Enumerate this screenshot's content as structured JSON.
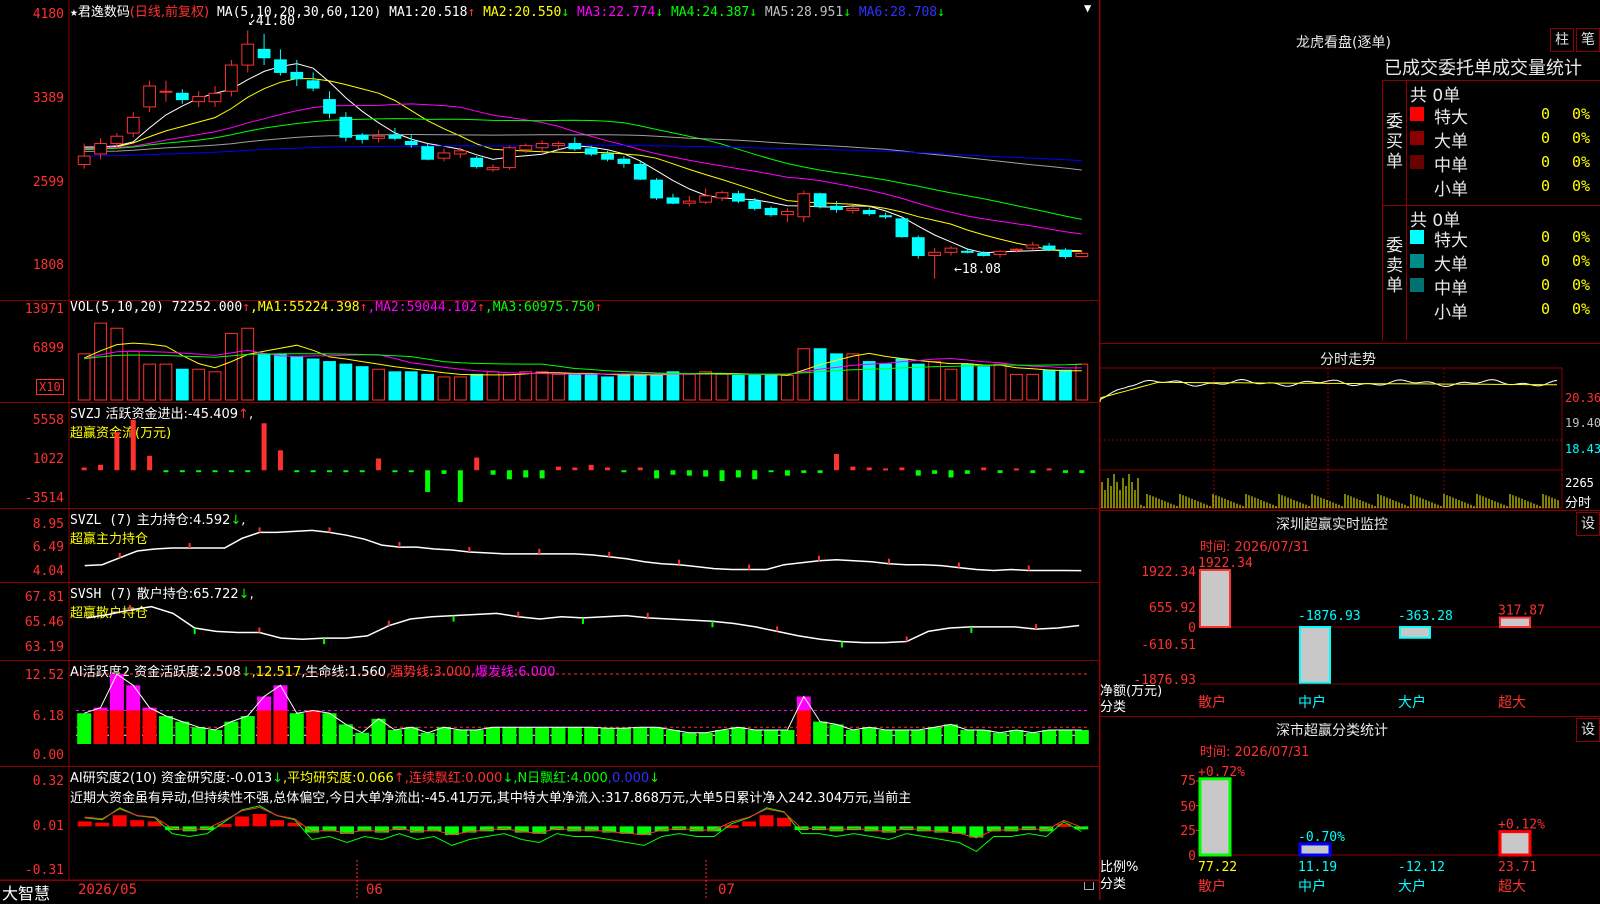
{
  "colors": {
    "up": "#ff3030",
    "down": "#00ffff",
    "grid": "#8b0000",
    "ma1": "#ffffff",
    "ma2": "#ffff00",
    "ma3": "#ff00ff",
    "ma4": "#00ff00",
    "ma5": "#a0a0a0",
    "ma6": "#0000ff"
  },
  "title_bar": {
    "star": "★",
    "stock": "君逸数码",
    "period": "(日线,前复权)"
  },
  "main": {
    "axis": [
      "4180",
      "3389",
      "2599",
      "1808"
    ],
    "ma_label": "MA(5,10,20,30,60,120)",
    "mas": [
      {
        "name": "MA1:",
        "value": "20.518",
        "arrow": "↑",
        "color": "#ffffff"
      },
      {
        "name": "MA2:",
        "value": "20.550",
        "arrow": "↓",
        "color": "#ffff00"
      },
      {
        "name": "MA3:",
        "value": "22.774",
        "arrow": "↓",
        "color": "#ff00ff"
      },
      {
        "name": "MA4:",
        "value": "24.387",
        "arrow": "↓",
        "color": "#00ff00"
      },
      {
        "name": "MA5:",
        "value": "28.951",
        "arrow": "↓",
        "color": "#c0c0c0"
      },
      {
        "name": "MA6:",
        "value": "28.708",
        "arrow": "↓",
        "color": "#3030ff"
      }
    ],
    "high_label": "41.80",
    "low_label": "←18.08"
  },
  "vol": {
    "axis": [
      "13971",
      "6899"
    ],
    "unit": "X10",
    "label": "VOL(5,10,20)",
    "value": "72252.000",
    "arrow": "↑",
    "mas": [
      {
        "name": "MA1:",
        "value": "55224.398",
        "arrow": "↑",
        "color": "#ffff00"
      },
      {
        "name": "MA2:",
        "value": "59044.102",
        "arrow": "↑",
        "color": "#ff00ff"
      },
      {
        "name": "MA3:",
        "value": "60975.750",
        "arrow": "↑",
        "color": "#00ff00"
      }
    ]
  },
  "svzj": {
    "axis": [
      "5558",
      "1022",
      "-3514"
    ],
    "label": "SVZJ",
    "line1": "活跃资金进出:",
    "value": "-45.409",
    "arrow": "↑",
    "tail": ",",
    "sub": "超赢资金流(万元)"
  },
  "svzl": {
    "axis": [
      "8.95",
      "6.49",
      "4.04"
    ],
    "label": "SVZL (7)",
    "line1": "主力持仓:",
    "value": "4.592",
    "arrow": "↓",
    "tail": ",",
    "sub": "超赢主力持仓"
  },
  "svsh": {
    "axis": [
      "67.81",
      "65.46",
      "63.19"
    ],
    "label": "SVSH (7)",
    "line1": "散户持仓:",
    "value": "65.722",
    "arrow": "↓",
    "tail": ",",
    "sub": "超赢散户持仓"
  },
  "ai1": {
    "axis": [
      "12.52",
      "6.18",
      "0.00"
    ],
    "label": "AI活跃度2",
    "items": [
      {
        "t": "资金活跃度:",
        "v": "2.508",
        "a": "↓",
        "c": "#ffffff"
      },
      {
        "t": ",",
        "v": "12.517",
        "a": "",
        "c": "#ffff00"
      },
      {
        "t": ",生命线:",
        "v": "1.560",
        "a": "",
        "c": "#ffffff"
      },
      {
        "t": ",强势线:",
        "v": "3.000",
        "a": "",
        "c": "#ff3030"
      },
      {
        "t": ",爆发线:",
        "v": "6.000",
        "a": "",
        "c": "#ff00ff"
      }
    ]
  },
  "ai2": {
    "axis": [
      "0.32",
      "0.01",
      "-0.31"
    ],
    "label": "AI研究度2(10)",
    "items": [
      {
        "t": "资金研究度:",
        "v": "-0.013",
        "a": "↓",
        "c": "#ffffff"
      },
      {
        "t": ",平均研究度:",
        "v": "0.066",
        "a": "↑",
        "c": "#ffff00"
      },
      {
        "t": ",连续飘红:",
        "v": "0.000",
        "a": "↓",
        "c": "#ff3030"
      },
      {
        "t": ",N日飘红:",
        "v": "4.000",
        "a": "",
        "c": "#00ff00"
      },
      {
        "t": ",",
        "v": "0.000",
        "a": "↓",
        "c": "#3030ff"
      }
    ],
    "comment": "近期大资金虽有异动,但持续性不强,总体偏空,今日大单净流出:-45.41万元,其中特大单净流入:317.868万元,大单5日累计净入242.304万元,当前主"
  },
  "date_axis": {
    "brand": "大智慧",
    "labels": [
      "2026/05",
      "06",
      "07"
    ]
  },
  "right": {
    "dragon_title": "龙虎看盘(逐单)",
    "btn_bar": "柱",
    "btn_pen": "笔",
    "stats_title": "已成交委托单成交量统计",
    "buy": {
      "side": "委买单",
      "total": "共 0单",
      "rows": [
        {
          "name": "特大",
          "n": "0",
          "p": "0%",
          "color": "#ff0000"
        },
        {
          "name": "大单",
          "n": "0",
          "p": "0%",
          "color": "#8b0000"
        },
        {
          "name": "中单",
          "n": "0",
          "p": "0%",
          "color": "#6a0000"
        },
        {
          "name": "小单",
          "n": "0",
          "p": "0%",
          "color": ""
        }
      ]
    },
    "sell": {
      "side": "委卖单",
      "total": "共 0单",
      "rows": [
        {
          "name": "特大",
          "n": "0",
          "p": "0%",
          "color": "#00ffff"
        },
        {
          "name": "大单",
          "n": "0",
          "p": "0%",
          "color": "#008b8b"
        },
        {
          "name": "中单",
          "n": "0",
          "p": "0%",
          "color": "#007070"
        },
        {
          "name": "小单",
          "n": "0",
          "p": "0%",
          "color": ""
        }
      ]
    },
    "intraday": {
      "title": "分时走势",
      "axis": [
        "20.36",
        "19.40",
        "18.43"
      ],
      "vol_axis": "2265",
      "vol_unit": "分时"
    },
    "sz_monitor": {
      "title": "深圳超赢实时监控",
      "btn": "设",
      "time": "时间: 2026/07/31",
      "axis": [
        "1922.34",
        "655.92",
        "0",
        "-610.51",
        "-1876.93"
      ],
      "ylabel1": "净额(万元)",
      "ylabel2": "分类",
      "cats": [
        "散户",
        "中户",
        "大户",
        "超大"
      ],
      "vals": [
        "1922.34",
        "-1876.93",
        "-363.28",
        "317.87"
      ]
    },
    "sz_class": {
      "title": "深市超赢分类统计",
      "btn": "设",
      "time": "时间: 2026/07/31",
      "axis": [
        "75",
        "50",
        "25",
        "0"
      ],
      "ylabel1": "比例%",
      "ylabel2": "分类",
      "cats": [
        "散户",
        "中户",
        "大户",
        "超大"
      ],
      "top": [
        "+0.72%",
        "-0.70%",
        "",
        "+0.12%"
      ],
      "vals": [
        "77.22",
        "11.19",
        "-12.12",
        "23.71"
      ]
    }
  },
  "chart_data": [
    {
      "type": "candlestick",
      "title": "君逸数码 (日线,前复权)",
      "ylim": [
        18.08,
        41.8
      ],
      "ohlc": [
        [
          29,
          31,
          28.6,
          29.8
        ],
        [
          30,
          31.5,
          29.5,
          31
        ],
        [
          31,
          32,
          30.5,
          31.7
        ],
        [
          32,
          34,
          31.6,
          33.5
        ],
        [
          34.5,
          37,
          34,
          36.5
        ],
        [
          36,
          37,
          35,
          36
        ],
        [
          35.8,
          36.2,
          34.8,
          35.2
        ],
        [
          35,
          36,
          34.5,
          35.5
        ],
        [
          35,
          36.5,
          34.5,
          35.8
        ],
        [
          36,
          39,
          35.5,
          38.5
        ],
        [
          38.5,
          41.8,
          37.8,
          40.5
        ],
        [
          40,
          41.5,
          38.5,
          39.2
        ],
        [
          39,
          40,
          37.5,
          37.8
        ],
        [
          37.8,
          39,
          36.5,
          37.2
        ],
        [
          37,
          37.8,
          36,
          36.3
        ],
        [
          35.2,
          36,
          33.4,
          33.9
        ],
        [
          33.5,
          34,
          31.2,
          31.6
        ],
        [
          31.8,
          32,
          31,
          31.4
        ],
        [
          31.5,
          32.3,
          31.1,
          31.7
        ],
        [
          31.8,
          32.5,
          31.3,
          31.5
        ],
        [
          31.2,
          31.8,
          30.6,
          30.9
        ],
        [
          30.7,
          31,
          29.4,
          29.5
        ],
        [
          29.6,
          30.5,
          29.3,
          30.1
        ],
        [
          30,
          30.6,
          29.6,
          30.3
        ],
        [
          29.6,
          29.8,
          28.6,
          28.8
        ],
        [
          28.5,
          29,
          28.3,
          28.7
        ],
        [
          28.7,
          30.8,
          28.5,
          30.6
        ],
        [
          30.4,
          31,
          30.1,
          30.8
        ],
        [
          30.6,
          31.3,
          30.2,
          31
        ],
        [
          30.8,
          31.2,
          30.4,
          31
        ],
        [
          31,
          31.6,
          30.3,
          30.5
        ],
        [
          30.5,
          30.8,
          29.8,
          30
        ],
        [
          30,
          30.3,
          29.3,
          29.5
        ],
        [
          29.5,
          29.8,
          28.7,
          29.1
        ],
        [
          29,
          29.3,
          27.5,
          27.6
        ],
        [
          27.5,
          27.7,
          25.6,
          25.8
        ],
        [
          25.8,
          26.2,
          25.2,
          25.3
        ],
        [
          25.3,
          26,
          25,
          25.5
        ],
        [
          25.4,
          26.7,
          25.2,
          26
        ],
        [
          25.8,
          26.5,
          25.5,
          26.3
        ],
        [
          26.2,
          26.5,
          25.3,
          25.5
        ],
        [
          25.5,
          25.8,
          24.6,
          24.8
        ],
        [
          24.8,
          25,
          24,
          24.2
        ],
        [
          24.2,
          24.8,
          23.5,
          24.5
        ],
        [
          24,
          26.5,
          23.5,
          26.2
        ],
        [
          26.2,
          26.3,
          24.8,
          25
        ],
        [
          25,
          25.5,
          24.4,
          24.7
        ],
        [
          24.6,
          25,
          24.3,
          24.8
        ],
        [
          24.6,
          24.9,
          24.1,
          24.3
        ],
        [
          24.1,
          24.4,
          23.8,
          24
        ],
        [
          23.8,
          23.9,
          22,
          22.1
        ],
        [
          22,
          22.2,
          20,
          20.3
        ],
        [
          20.3,
          21,
          18.08,
          20.6
        ],
        [
          20.6,
          21.2,
          20.3,
          21
        ],
        [
          20.7,
          21,
          20.5,
          20.6
        ],
        [
          20.5,
          20.7,
          20.2,
          20.3
        ],
        [
          20.4,
          20.8,
          20.1,
          20.7
        ],
        [
          20.8,
          21,
          20.6,
          20.9
        ],
        [
          21,
          21.6,
          20.8,
          21.3
        ],
        [
          21.2,
          21.5,
          20.7,
          20.9
        ],
        [
          20.8,
          21,
          20,
          20.2
        ],
        [
          20.2,
          20.8,
          20.1,
          20.5
        ]
      ]
    },
    {
      "type": "bar",
      "title": "VOL(5,10,20)",
      "values": [
        9,
        15,
        14,
        9.5,
        7,
        7,
        6,
        6,
        5.5,
        13,
        14,
        9,
        9,
        8.5,
        8,
        7.5,
        7,
        6.5,
        6,
        5.5,
        5.5,
        5,
        4.5,
        4.5,
        5,
        5.5,
        5,
        5.5,
        5.5,
        5,
        5,
        5,
        4.5,
        5,
        5,
        5,
        5.5,
        5,
        5.5,
        5,
        4.8,
        4.8,
        4.8,
        4.8,
        10,
        10,
        9,
        9,
        7.5,
        7,
        8,
        7,
        7.5,
        6,
        7,
        6.5,
        7,
        5,
        5,
        5.8,
        5.8,
        7
      ]
    },
    {
      "type": "bar",
      "title": "SVZJ 超赢资金流(万元)",
      "values": [
        300,
        600,
        4200,
        5558,
        1600,
        -200,
        -200,
        -200,
        -200,
        -200,
        -100,
        5200,
        2200,
        -100,
        -100,
        -100,
        -200,
        -100,
        1300,
        -100,
        -200,
        -2400,
        -400,
        -3514,
        1400,
        -500,
        -1000,
        -800,
        -900,
        400,
        300,
        600,
        300,
        -100,
        300,
        -900,
        -500,
        -600,
        -700,
        -1200,
        -800,
        -1000,
        -200,
        -600,
        -300,
        -300,
        1800,
        400,
        300,
        200,
        300,
        -600,
        -400,
        -800,
        -400,
        300,
        -300,
        200,
        -300,
        200,
        -300,
        -300
      ]
    },
    {
      "type": "line",
      "title": "SVZL 超赢主力持仓",
      "ylim": [
        4.04,
        8.95
      ],
      "values": [
        5.1,
        5.2,
        5.9,
        6.6,
        6.8,
        6.9,
        6.9,
        6.9,
        6.9,
        7.9,
        8.5,
        8.5,
        8.6,
        8.7,
        8.5,
        8.2,
        7.8,
        7.2,
        7,
        7,
        6.8,
        6.7,
        6.5,
        6.4,
        6.3,
        6.3,
        6.3,
        6.3,
        6.3,
        6.2,
        6,
        5.8,
        5.5,
        5.3,
        5.2,
        5,
        4.8,
        4.7,
        4.7,
        4.7,
        5.2,
        5.4,
        5.6,
        5.7,
        5.6,
        5.5,
        5.3,
        5.2,
        5.2,
        5.1,
        4.9,
        4.7,
        4.6,
        4.7,
        4.6,
        4.6,
        4.6,
        4.59
      ]
    },
    {
      "type": "line",
      "title": "SVSH 超赢散户持仓",
      "ylim": [
        63.19,
        67.81
      ],
      "values": [
        66.4,
        66.7,
        67.1,
        67.4,
        66.8,
        65.5,
        65.2,
        65.1,
        65.1,
        64.6,
        64.5,
        64.6,
        64.6,
        64.8,
        65.7,
        66.3,
        66.5,
        66.6,
        66.7,
        66.8,
        66.5,
        66.3,
        66.5,
        66.4,
        66.5,
        66.6,
        66.4,
        66.3,
        66.2,
        66.1,
        65.9,
        65.6,
        65.2,
        64.8,
        64.5,
        64.3,
        64.2,
        64.2,
        64.3,
        65.2,
        65.5,
        65.6,
        65.6,
        65.6,
        65.4,
        65.5,
        65.72
      ]
    },
    {
      "type": "bar",
      "title": "AI活跃度2 资金活跃度",
      "ylim": [
        0,
        12.52
      ],
      "values": [
        5.5,
        6.5,
        12.5,
        10.5,
        6.5,
        5,
        4,
        3,
        2.5,
        4,
        5,
        8.5,
        10.5,
        5.5,
        6,
        5.5,
        3.5,
        2,
        4.5,
        2.5,
        3,
        2,
        3,
        2.5,
        2.5,
        3,
        3,
        3,
        3,
        3,
        3,
        3,
        2.8,
        2.8,
        3,
        3,
        2.5,
        2,
        2,
        2.5,
        3,
        2.5,
        2.5,
        2.5,
        8.5,
        4,
        3.5,
        2.5,
        3,
        2.5,
        2.5,
        2.5,
        3,
        3.5,
        2.5,
        2.5,
        2,
        2.5,
        2,
        2.5,
        2.5,
        2.508
      ]
    },
    {
      "type": "bar",
      "title": "AI研究度2(10) 资金研究度",
      "ylim": [
        -0.31,
        0.32
      ],
      "values": [
        0.05,
        0.04,
        0.1,
        0.06,
        0.05,
        -0.02,
        -0.03,
        -0.02,
        0.03,
        0.09,
        0.11,
        0.06,
        0.04,
        -0.04,
        -0.03,
        -0.05,
        -0.03,
        -0.04,
        -0.02,
        -0.04,
        -0.03,
        -0.06,
        -0.04,
        -0.03,
        -0.02,
        -0.04,
        -0.05,
        -0.02,
        -0.03,
        -0.03,
        -0.04,
        -0.05,
        -0.06,
        -0.03,
        -0.02,
        -0.03,
        -0.03,
        0.02,
        0.05,
        0.1,
        0.08,
        -0.02,
        -0.02,
        -0.03,
        -0.02,
        -0.03,
        -0.04,
        -0.02,
        -0.03,
        -0.04,
        -0.05,
        -0.08,
        -0.03,
        -0.03,
        -0.02,
        -0.03,
        0.03,
        -0.013
      ]
    },
    {
      "type": "bar",
      "title": "深圳超赢实时监控 净额(万元)",
      "categories": [
        "散户",
        "中户",
        "大户",
        "超大"
      ],
      "values": [
        1922.34,
        -1876.93,
        -363.28,
        317.87
      ]
    },
    {
      "type": "bar",
      "title": "深市超赢分类统计 比例%",
      "categories": [
        "散户",
        "中户",
        "大户",
        "超大"
      ],
      "values": [
        77.22,
        11.19,
        -12.12,
        23.71
      ],
      "ylim": [
        0,
        75
      ]
    }
  ]
}
